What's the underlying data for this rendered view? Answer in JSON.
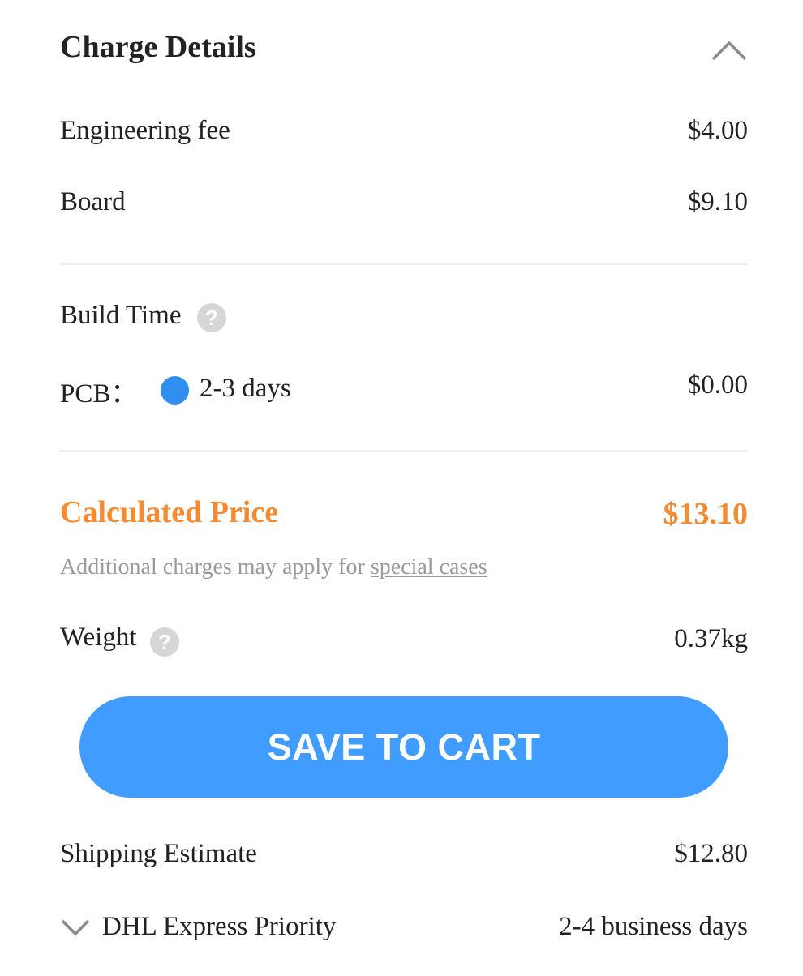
{
  "header": {
    "title": "Charge Details",
    "collapse_icon": "chevron-up-icon"
  },
  "charges": [
    {
      "label": "Engineering fee",
      "value": "$4.00"
    },
    {
      "label": "Board",
      "value": "$9.10"
    }
  ],
  "build_time": {
    "label": "Build Time",
    "help_icon": "question-circle-icon",
    "help_glyph": "?",
    "pcb_label": "PCB：",
    "option_label": "2-3 days",
    "option_price": "$0.00",
    "radio_color": "#2f8ef0"
  },
  "price": {
    "label": "Calculated Price",
    "value": "$13.10",
    "color": "#f58a30",
    "note_text": "Additional charges may apply for ",
    "note_link": "special cases"
  },
  "weight": {
    "label": "Weight",
    "help_icon": "question-circle-icon",
    "help_glyph": "?",
    "value": "0.37kg"
  },
  "cart_button": {
    "label": "SAVE TO CART",
    "color": "#409dff"
  },
  "shipping": {
    "label": "Shipping Estimate",
    "value": "$12.80",
    "method": "DHL Express Priority",
    "method_icon": "chevron-down-icon",
    "delivery": "2-4 business days"
  }
}
